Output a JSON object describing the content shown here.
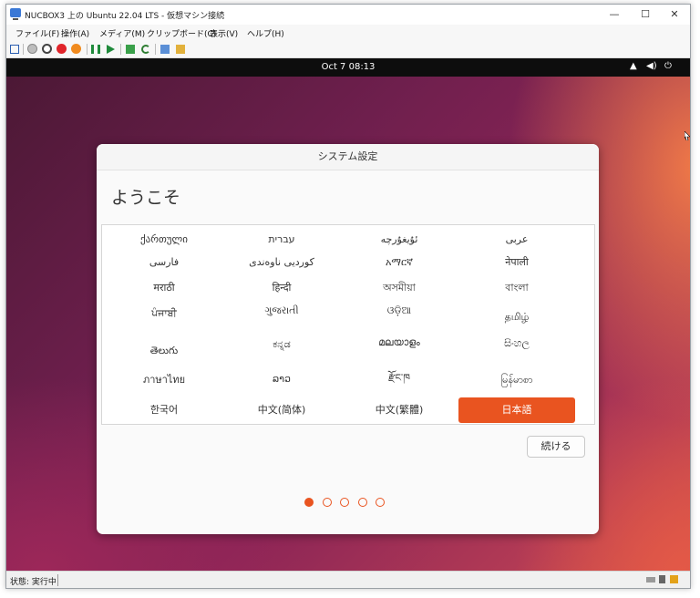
{
  "window": {
    "title": "NUCBOX3 上の Ubuntu 22.04 LTS - 仮想マシン接続",
    "controls": {
      "minimize": "—",
      "maximize": "☐",
      "close": "✕"
    }
  },
  "menubar": {
    "items": [
      "ファイル(F)",
      "操作(A)",
      "メディア(M)",
      "クリップボード(C)",
      "表示(V)",
      "ヘルプ(H)"
    ]
  },
  "toolbar": {
    "icons": [
      "ctrl-alt-del-icon",
      "stop-icon",
      "start-icon",
      "turnoff-icon",
      "shutdown-icon",
      "pause-icon",
      "resume-icon",
      "checkpoint-icon",
      "revert-icon",
      "enhanced-session-icon",
      "share-icon"
    ]
  },
  "guest": {
    "topbar": {
      "clock": "Oct 7  08:13",
      "icons": [
        "network-icon",
        "volume-icon",
        "power-icon"
      ]
    },
    "dialog": {
      "title": "システム設定",
      "heading": "ようこそ",
      "languages": [
        [
          "ქართული",
          "עברית",
          "ئۇيغۇرچە",
          "عربى"
        ],
        [
          "فارسی",
          "کوردیی ناوەندی",
          "አማርኛ",
          "नेपाली"
        ],
        [
          "मराठी",
          "हिन्दी",
          "অসমীয়া",
          "বাংলা"
        ],
        [
          "ਪੰਜਾਬੀ",
          "ગુજરાતી",
          "ଓଡ଼ିଆ",
          "தமிழ்"
        ],
        [
          "తెలుగు",
          "ಕನ್ನಡ",
          "മലയാളം",
          "සිංහල"
        ],
        [
          "ภาษาไทย",
          "ລາວ",
          "རྫོང་ཁ",
          "မြန်မာစာ"
        ],
        [
          "한국어",
          "中文(简体)",
          "中文(繁體)",
          "日本語"
        ]
      ],
      "selected_language": "日本語",
      "continue_label": "続ける",
      "steps": {
        "total": 5,
        "current": 1
      }
    }
  },
  "statusbar": {
    "text": "状態: 実行中"
  },
  "colors": {
    "accent": "#E95420",
    "topbar": "#0D0D0D"
  }
}
